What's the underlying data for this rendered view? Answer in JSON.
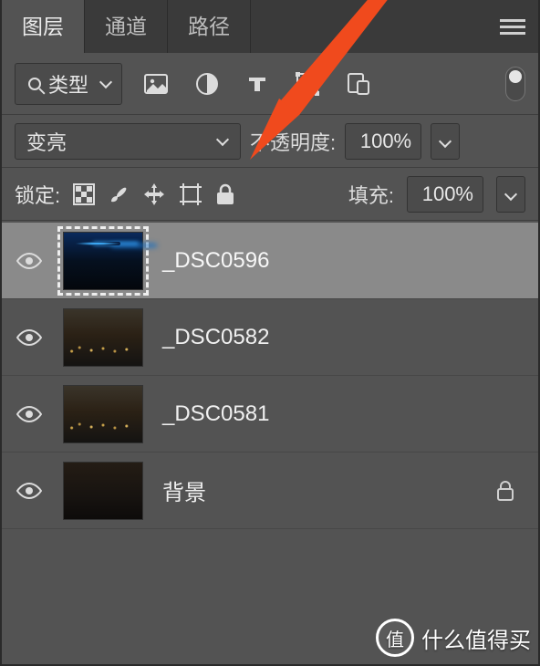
{
  "tabs": {
    "t0": "图层",
    "t1": "通道",
    "t2": "路径"
  },
  "filter": {
    "type_label": "类型"
  },
  "blend": {
    "mode_label": "变亮",
    "opacity_label": "不透明度:",
    "opacity_value": "100%"
  },
  "lock": {
    "label": "锁定:",
    "fill_label": "填充:",
    "fill_value": "100%"
  },
  "layers": [
    {
      "name": "_DSC0596",
      "selected": true,
      "thumb": "nightblue",
      "locked": false
    },
    {
      "name": "_DSC0582",
      "selected": false,
      "thumb": "city",
      "locked": false
    },
    {
      "name": "_DSC0581",
      "selected": false,
      "thumb": "city",
      "locked": false
    },
    {
      "name": "背景",
      "selected": false,
      "thumb": "dark",
      "locked": true
    }
  ],
  "watermark": {
    "badge": "值",
    "text": "什么值得买"
  }
}
